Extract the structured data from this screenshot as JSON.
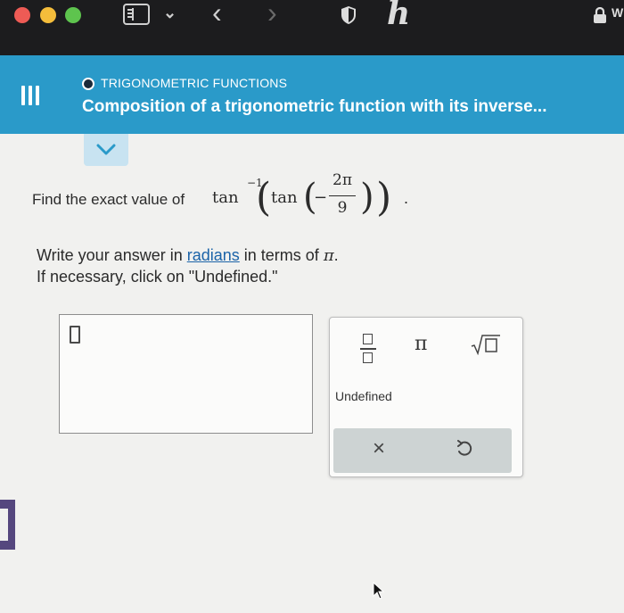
{
  "browser": {
    "chrome_fragment_text": "W",
    "logo_text": "ℎ"
  },
  "header": {
    "topic": "TRIGONOMETRIC FUNCTIONS",
    "title": "Composition of a trigonometric function with its inverse..."
  },
  "problem": {
    "prompt": "Find the exact value of",
    "outer_function": "tan",
    "outer_exponent": "−1",
    "inner_function": "tan",
    "sign": "−",
    "numerator": "2π",
    "denominator": "9",
    "period": ".",
    "instruction_pre": "Write your answer in ",
    "instruction_link": "radians",
    "instruction_mid": " in terms of ",
    "instruction_pi": "π",
    "instruction_end": ".",
    "instruction_line2": "If necessary, click on \"Undefined.\""
  },
  "answer": {
    "value": ""
  },
  "keypad": {
    "pi_label": "π",
    "undefined_label": "Undefined",
    "clear_label": "×"
  },
  "colors": {
    "header_bg": "#2a9ac9",
    "link": "#1b63a8",
    "keypad_footer": "#cdd3d3"
  }
}
